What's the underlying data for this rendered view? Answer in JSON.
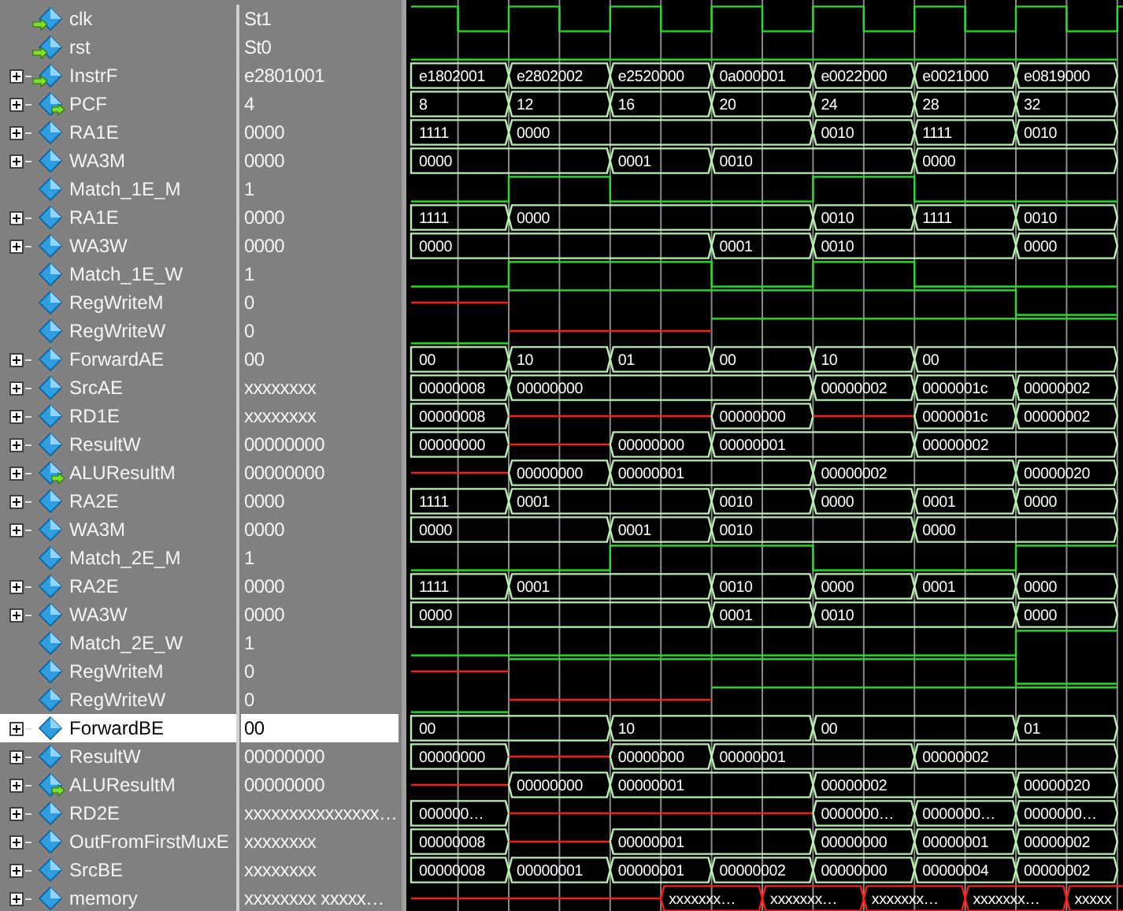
{
  "signals": [
    {
      "name": "clk",
      "value": "St1",
      "expandable": false,
      "kind": "input",
      "selected": false,
      "wave": {
        "kind": "clock"
      }
    },
    {
      "name": "rst",
      "value": "St0",
      "expandable": false,
      "kind": "input",
      "selected": false,
      "wave": {
        "kind": "bit",
        "cycles": [
          {
            "high": false
          },
          {
            "high": false
          },
          {
            "high": false
          },
          {
            "high": false
          },
          {
            "high": false
          },
          {
            "high": false
          },
          {
            "high": false
          }
        ]
      }
    },
    {
      "name": "InstrF",
      "value": "e2801001",
      "expandable": true,
      "kind": "input",
      "selected": false,
      "wave": {
        "kind": "bus",
        "cycles": [
          {
            "label": "e1802001"
          },
          {
            "label": "e2802002"
          },
          {
            "label": "e2520000"
          },
          {
            "label": "0a000001"
          },
          {
            "label": "e0022000"
          },
          {
            "label": "e0021000"
          },
          {
            "label": "e0819000"
          }
        ]
      }
    },
    {
      "name": "PCF",
      "value": "4",
      "expandable": true,
      "kind": "output",
      "selected": false,
      "wave": {
        "kind": "bus",
        "cycles": [
          {
            "label": "8"
          },
          {
            "label": "12"
          },
          {
            "label": "16"
          },
          {
            "label": "20"
          },
          {
            "label": "24"
          },
          {
            "label": "28"
          },
          {
            "label": "32"
          }
        ]
      }
    },
    {
      "name": "RA1E",
      "value": "0000",
      "expandable": true,
      "kind": "internal",
      "selected": false,
      "wave": {
        "kind": "bus",
        "cycles": [
          {
            "label": "1111"
          },
          {
            "label": "0000"
          },
          {
            "held": true
          },
          {
            "held": true
          },
          {
            "label": "0010"
          },
          {
            "label": "1111"
          },
          {
            "label": "0010"
          }
        ]
      }
    },
    {
      "name": "WA3M",
      "value": "0000",
      "expandable": true,
      "kind": "internal",
      "selected": false,
      "wave": {
        "kind": "bus",
        "cycles": [
          {
            "label": "0000"
          },
          {
            "held": true
          },
          {
            "label": "0001"
          },
          {
            "label": "0010"
          },
          {
            "held": true
          },
          {
            "label": "0000"
          },
          {
            "held": true
          }
        ]
      }
    },
    {
      "name": "Match_1E_M",
      "value": "1",
      "expandable": false,
      "kind": "internal",
      "selected": false,
      "wave": {
        "kind": "bit",
        "cycles": [
          {
            "high": false
          },
          {
            "high": true
          },
          {
            "high": false
          },
          {
            "high": false
          },
          {
            "high": true
          },
          {
            "high": false
          },
          {
            "high": false
          }
        ]
      }
    },
    {
      "name": "RA1E",
      "value": "0000",
      "expandable": true,
      "kind": "internal",
      "selected": false,
      "wave": {
        "kind": "bus",
        "cycles": [
          {
            "label": "1111"
          },
          {
            "label": "0000"
          },
          {
            "held": true
          },
          {
            "held": true
          },
          {
            "label": "0010"
          },
          {
            "label": "1111"
          },
          {
            "label": "0010"
          }
        ]
      }
    },
    {
      "name": "WA3W",
      "value": "0000",
      "expandable": true,
      "kind": "internal",
      "selected": false,
      "wave": {
        "kind": "bus",
        "cycles": [
          {
            "label": "0000"
          },
          {
            "held": true
          },
          {
            "held": true
          },
          {
            "label": "0001"
          },
          {
            "label": "0010"
          },
          {
            "held": true
          },
          {
            "label": "0000"
          }
        ]
      }
    },
    {
      "name": "Match_1E_W",
      "value": "1",
      "expandable": false,
      "kind": "internal",
      "selected": false,
      "wave": {
        "kind": "bit",
        "cycles": [
          {
            "high": false
          },
          {
            "high": true
          },
          {
            "high": true
          },
          {
            "high": false
          },
          {
            "high": true
          },
          {
            "high": false
          },
          {
            "high": false
          }
        ]
      }
    },
    {
      "name": "RegWriteM",
      "value": "0",
      "expandable": false,
      "kind": "internal",
      "selected": false,
      "wave": {
        "kind": "bit",
        "cycles": [
          {
            "unknown": true
          },
          {
            "high": true
          },
          {
            "high": true
          },
          {
            "high": true
          },
          {
            "high": true
          },
          {
            "high": true
          },
          {
            "high": false
          }
        ]
      }
    },
    {
      "name": "RegWriteW",
      "value": "0",
      "expandable": false,
      "kind": "internal",
      "selected": false,
      "wave": {
        "kind": "bit",
        "cycles": [
          {
            "high": false
          },
          {
            "unknown": true
          },
          {
            "unknown": true
          },
          {
            "high": true
          },
          {
            "high": true
          },
          {
            "high": true
          },
          {
            "high": true
          }
        ]
      }
    },
    {
      "name": "ForwardAE",
      "value": "00",
      "expandable": true,
      "kind": "internal",
      "selected": false,
      "wave": {
        "kind": "bus",
        "cycles": [
          {
            "label": "00"
          },
          {
            "label": "10"
          },
          {
            "label": "01"
          },
          {
            "label": "00"
          },
          {
            "label": "10"
          },
          {
            "label": "00"
          },
          {
            "held": true
          }
        ]
      }
    },
    {
      "name": "SrcAE",
      "value": "xxxxxxxx",
      "expandable": true,
      "kind": "internal",
      "selected": false,
      "wave": {
        "kind": "bus",
        "cycles": [
          {
            "label": "00000008"
          },
          {
            "label": "00000000"
          },
          {
            "held": true
          },
          {
            "held": true
          },
          {
            "label": "00000002"
          },
          {
            "label": "0000001c"
          },
          {
            "label": "00000002"
          }
        ]
      }
    },
    {
      "name": "RD1E",
      "value": "xxxxxxxx",
      "expandable": true,
      "kind": "internal",
      "selected": false,
      "wave": {
        "kind": "bus",
        "cycles": [
          {
            "label": "00000008"
          },
          {
            "unknown": true
          },
          {
            "held": true
          },
          {
            "label": "00000000"
          },
          {
            "unknown": true
          },
          {
            "label": "0000001c"
          },
          {
            "label": "00000002"
          }
        ]
      }
    },
    {
      "name": "ResultW",
      "value": "00000000",
      "expandable": true,
      "kind": "internal",
      "selected": false,
      "wave": {
        "kind": "bus",
        "cycles": [
          {
            "label": "00000000"
          },
          {
            "unknown": true
          },
          {
            "label": "00000000"
          },
          {
            "label": "00000001"
          },
          {
            "held": true
          },
          {
            "label": "00000002"
          },
          {
            "held": true
          }
        ]
      }
    },
    {
      "name": "ALUResultM",
      "value": "00000000",
      "expandable": true,
      "kind": "output",
      "selected": false,
      "wave": {
        "kind": "bus",
        "cycles": [
          {
            "unknown": true
          },
          {
            "label": "00000000"
          },
          {
            "label": "00000001"
          },
          {
            "held": true
          },
          {
            "label": "00000002"
          },
          {
            "held": true
          },
          {
            "label": "00000020"
          }
        ]
      }
    },
    {
      "name": "RA2E",
      "value": "0000",
      "expandable": true,
      "kind": "internal",
      "selected": false,
      "wave": {
        "kind": "bus",
        "cycles": [
          {
            "label": "1111"
          },
          {
            "label": "0001"
          },
          {
            "held": true
          },
          {
            "label": "0010"
          },
          {
            "label": "0000"
          },
          {
            "label": "0001"
          },
          {
            "label": "0000"
          }
        ]
      }
    },
    {
      "name": "WA3M",
      "value": "0000",
      "expandable": true,
      "kind": "internal",
      "selected": false,
      "wave": {
        "kind": "bus",
        "cycles": [
          {
            "label": "0000"
          },
          {
            "held": true
          },
          {
            "label": "0001"
          },
          {
            "label": "0010"
          },
          {
            "held": true
          },
          {
            "label": "0000"
          },
          {
            "held": true
          }
        ]
      }
    },
    {
      "name": "Match_2E_M",
      "value": "1",
      "expandable": false,
      "kind": "internal",
      "selected": false,
      "wave": {
        "kind": "bit",
        "cycles": [
          {
            "high": false
          },
          {
            "high": false
          },
          {
            "high": true
          },
          {
            "high": true
          },
          {
            "high": false
          },
          {
            "high": false
          },
          {
            "high": true
          }
        ]
      }
    },
    {
      "name": "RA2E",
      "value": "0000",
      "expandable": true,
      "kind": "internal",
      "selected": false,
      "wave": {
        "kind": "bus",
        "cycles": [
          {
            "label": "1111"
          },
          {
            "label": "0001"
          },
          {
            "held": true
          },
          {
            "label": "0010"
          },
          {
            "label": "0000"
          },
          {
            "label": "0001"
          },
          {
            "label": "0000"
          }
        ]
      }
    },
    {
      "name": "WA3W",
      "value": "0000",
      "expandable": true,
      "kind": "internal",
      "selected": false,
      "wave": {
        "kind": "bus",
        "cycles": [
          {
            "label": "0000"
          },
          {
            "held": true
          },
          {
            "held": true
          },
          {
            "label": "0001"
          },
          {
            "label": "0010"
          },
          {
            "held": true
          },
          {
            "label": "0000"
          }
        ]
      }
    },
    {
      "name": "Match_2E_W",
      "value": "1",
      "expandable": false,
      "kind": "internal",
      "selected": false,
      "wave": {
        "kind": "bit",
        "cycles": [
          {
            "high": false
          },
          {
            "high": false
          },
          {
            "high": false
          },
          {
            "high": false
          },
          {
            "high": false
          },
          {
            "high": false
          },
          {
            "high": true
          }
        ]
      }
    },
    {
      "name": "RegWriteM",
      "value": "0",
      "expandable": false,
      "kind": "internal",
      "selected": false,
      "wave": {
        "kind": "bit",
        "cycles": [
          {
            "unknown": true
          },
          {
            "high": true
          },
          {
            "high": true
          },
          {
            "high": true
          },
          {
            "high": true
          },
          {
            "high": true
          },
          {
            "high": false
          }
        ]
      }
    },
    {
      "name": "RegWriteW",
      "value": "0",
      "expandable": false,
      "kind": "internal",
      "selected": false,
      "wave": {
        "kind": "bit",
        "cycles": [
          {
            "high": false
          },
          {
            "unknown": true
          },
          {
            "unknown": true
          },
          {
            "high": true
          },
          {
            "high": true
          },
          {
            "high": true
          },
          {
            "high": true
          }
        ]
      }
    },
    {
      "name": "ForwardBE",
      "value": "00",
      "expandable": true,
      "kind": "internal",
      "selected": true,
      "wave": {
        "kind": "bus",
        "cycles": [
          {
            "label": "00"
          },
          {
            "held": true
          },
          {
            "label": "10"
          },
          {
            "held": true
          },
          {
            "label": "00"
          },
          {
            "held": true
          },
          {
            "label": "01"
          }
        ]
      }
    },
    {
      "name": "ResultW",
      "value": "00000000",
      "expandable": true,
      "kind": "internal",
      "selected": false,
      "wave": {
        "kind": "bus",
        "cycles": [
          {
            "label": "00000000"
          },
          {
            "unknown": true
          },
          {
            "label": "00000000"
          },
          {
            "label": "00000001"
          },
          {
            "held": true
          },
          {
            "label": "00000002"
          },
          {
            "held": true
          }
        ]
      }
    },
    {
      "name": "ALUResultM",
      "value": "00000000",
      "expandable": true,
      "kind": "output",
      "selected": false,
      "wave": {
        "kind": "bus",
        "cycles": [
          {
            "unknown": true
          },
          {
            "label": "00000000"
          },
          {
            "label": "00000001"
          },
          {
            "held": true
          },
          {
            "label": "00000002"
          },
          {
            "held": true
          },
          {
            "label": "00000020"
          }
        ]
      }
    },
    {
      "name": "RD2E",
      "value": "xxxxxxxxxxxxxxx…",
      "expandable": true,
      "kind": "internal",
      "selected": false,
      "wave": {
        "kind": "bus",
        "cycles": [
          {
            "label": "000000…"
          },
          {
            "unknown": true
          },
          {
            "held": true
          },
          {
            "held": true
          },
          {
            "label": "0000000…"
          },
          {
            "label": "0000000…"
          },
          {
            "label": "0000000…"
          }
        ]
      }
    },
    {
      "name": "OutFromFirstMuxE",
      "value": "xxxxxxxx",
      "expandable": true,
      "kind": "internal",
      "selected": false,
      "wave": {
        "kind": "bus",
        "cycles": [
          {
            "label": "00000008"
          },
          {
            "unknown": true
          },
          {
            "label": "00000001"
          },
          {
            "held": true
          },
          {
            "label": "00000000"
          },
          {
            "label": "00000001"
          },
          {
            "label": "00000002"
          }
        ]
      }
    },
    {
      "name": "SrcBE",
      "value": "xxxxxxxx",
      "expandable": true,
      "kind": "internal",
      "selected": false,
      "wave": {
        "kind": "bus",
        "cycles": [
          {
            "label": "00000008"
          },
          {
            "label": "00000001"
          },
          {
            "label": "00000001"
          },
          {
            "label": "00000002"
          },
          {
            "label": "00000000"
          },
          {
            "label": "00000004"
          },
          {
            "label": "00000002"
          }
        ]
      }
    },
    {
      "name": "memory",
      "value": "xxxxxxxx xxxxx…",
      "expandable": true,
      "kind": "internal",
      "selected": false,
      "wave": {
        "kind": "offsetbus",
        "cycles": [
          {
            "unknown": true
          },
          {
            "held": true
          },
          {
            "label": "xxxxxxx…",
            "unknown": true
          },
          {
            "label": "xxxxxxx…",
            "unknown": true
          },
          {
            "label": "xxxxxxx…",
            "unknown": true
          },
          {
            "label": "xxxxxxx…",
            "unknown": true
          },
          {
            "label": "xxxxx",
            "unknown": true
          }
        ]
      }
    }
  ]
}
